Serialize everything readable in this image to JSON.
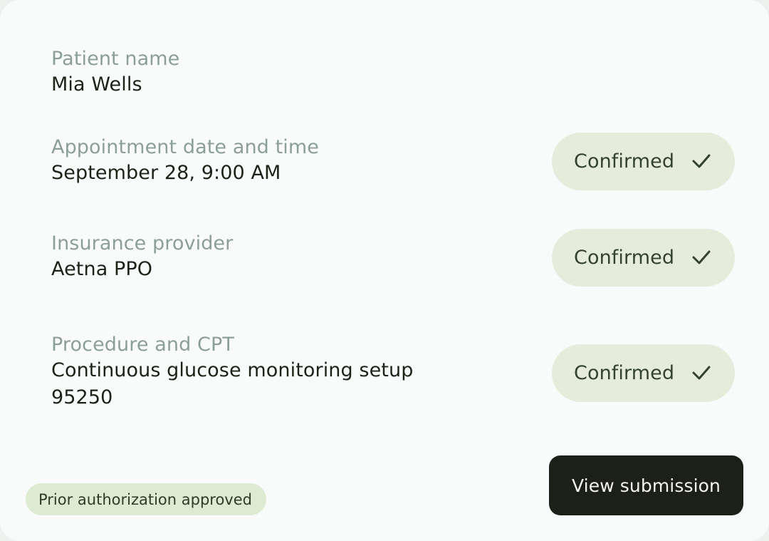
{
  "fields": {
    "patient": {
      "label": "Patient name",
      "value": "Mia Wells"
    },
    "appointment": {
      "label": "Appointment date and time",
      "value": "September 28, 9:00 AM",
      "status": "Confirmed"
    },
    "insurance": {
      "label": "Insurance provider",
      "value": "Aetna PPO",
      "status": "Confirmed"
    },
    "procedure": {
      "label": "Procedure and CPT",
      "value_line1": "Continuous glucose monitoring setup",
      "value_line2": "95250",
      "status": "Confirmed"
    }
  },
  "footer": {
    "badge": "Prior authorization approved",
    "button": "View submission"
  },
  "icons": {
    "status_check": "check-icon"
  },
  "colors": {
    "card_bg": "#f9fbfa",
    "label": "#8b9e98",
    "value": "#1d2219",
    "pill_bg": "#e6ecdc",
    "badge_bg": "#dcebd2",
    "button_bg": "#1d2016"
  }
}
